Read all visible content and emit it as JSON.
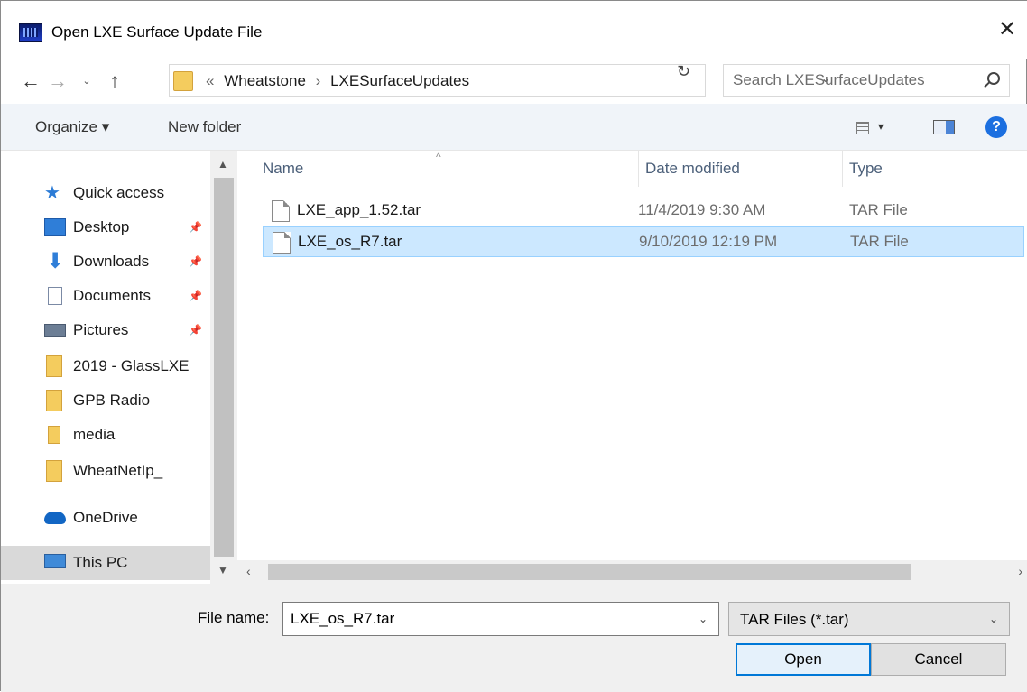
{
  "window": {
    "title": "Open LXE Surface Update File",
    "close_glyph": "✕"
  },
  "nav": {
    "back": "←",
    "forward": "→",
    "recent": "⌄",
    "up": "↑"
  },
  "address": {
    "prefix": "«",
    "parts": [
      "Wheatstone",
      "LXESurfaceUpdates"
    ],
    "separator": "›",
    "dropdown": "⌄",
    "refresh": "↻"
  },
  "search": {
    "placeholder": "Search LXESurfaceUpdates"
  },
  "toolbar": {
    "organize": "Organize ▾",
    "new_folder": "New folder",
    "view_dropdown": "▾",
    "help": "?"
  },
  "sidebar": {
    "quick_access": "Quick access",
    "items": [
      {
        "label": "Desktop",
        "pinned": true
      },
      {
        "label": "Downloads",
        "pinned": true
      },
      {
        "label": "Documents",
        "pinned": true
      },
      {
        "label": "Pictures",
        "pinned": true
      },
      {
        "label": "2019 - GlassLXE"
      },
      {
        "label": "GPB Radio"
      },
      {
        "label": "media"
      },
      {
        "label": "WheatNetIp_Screenshots"
      }
    ],
    "onedrive": "OneDrive",
    "this_pc": "This PC"
  },
  "columns": {
    "name": "Name",
    "date": "Date modified",
    "type": "Type",
    "sort_caret": "^"
  },
  "files": [
    {
      "name": "LXE_app_1.52.tar",
      "date": "11/4/2019 9:30 AM",
      "type": "TAR File",
      "selected": false
    },
    {
      "name": "LXE_os_R7.tar",
      "date": "9/10/2019 12:19 PM",
      "type": "TAR File",
      "selected": true
    }
  ],
  "footer": {
    "file_name_label": "File name:",
    "file_name_value": "LXE_os_R7.tar",
    "file_type": "TAR Files (*.tar)",
    "open": "Open",
    "cancel": "Cancel"
  },
  "colors": {
    "accent": "#0078d7",
    "selection": "#cce8ff",
    "folder": "#f4cc5e"
  }
}
